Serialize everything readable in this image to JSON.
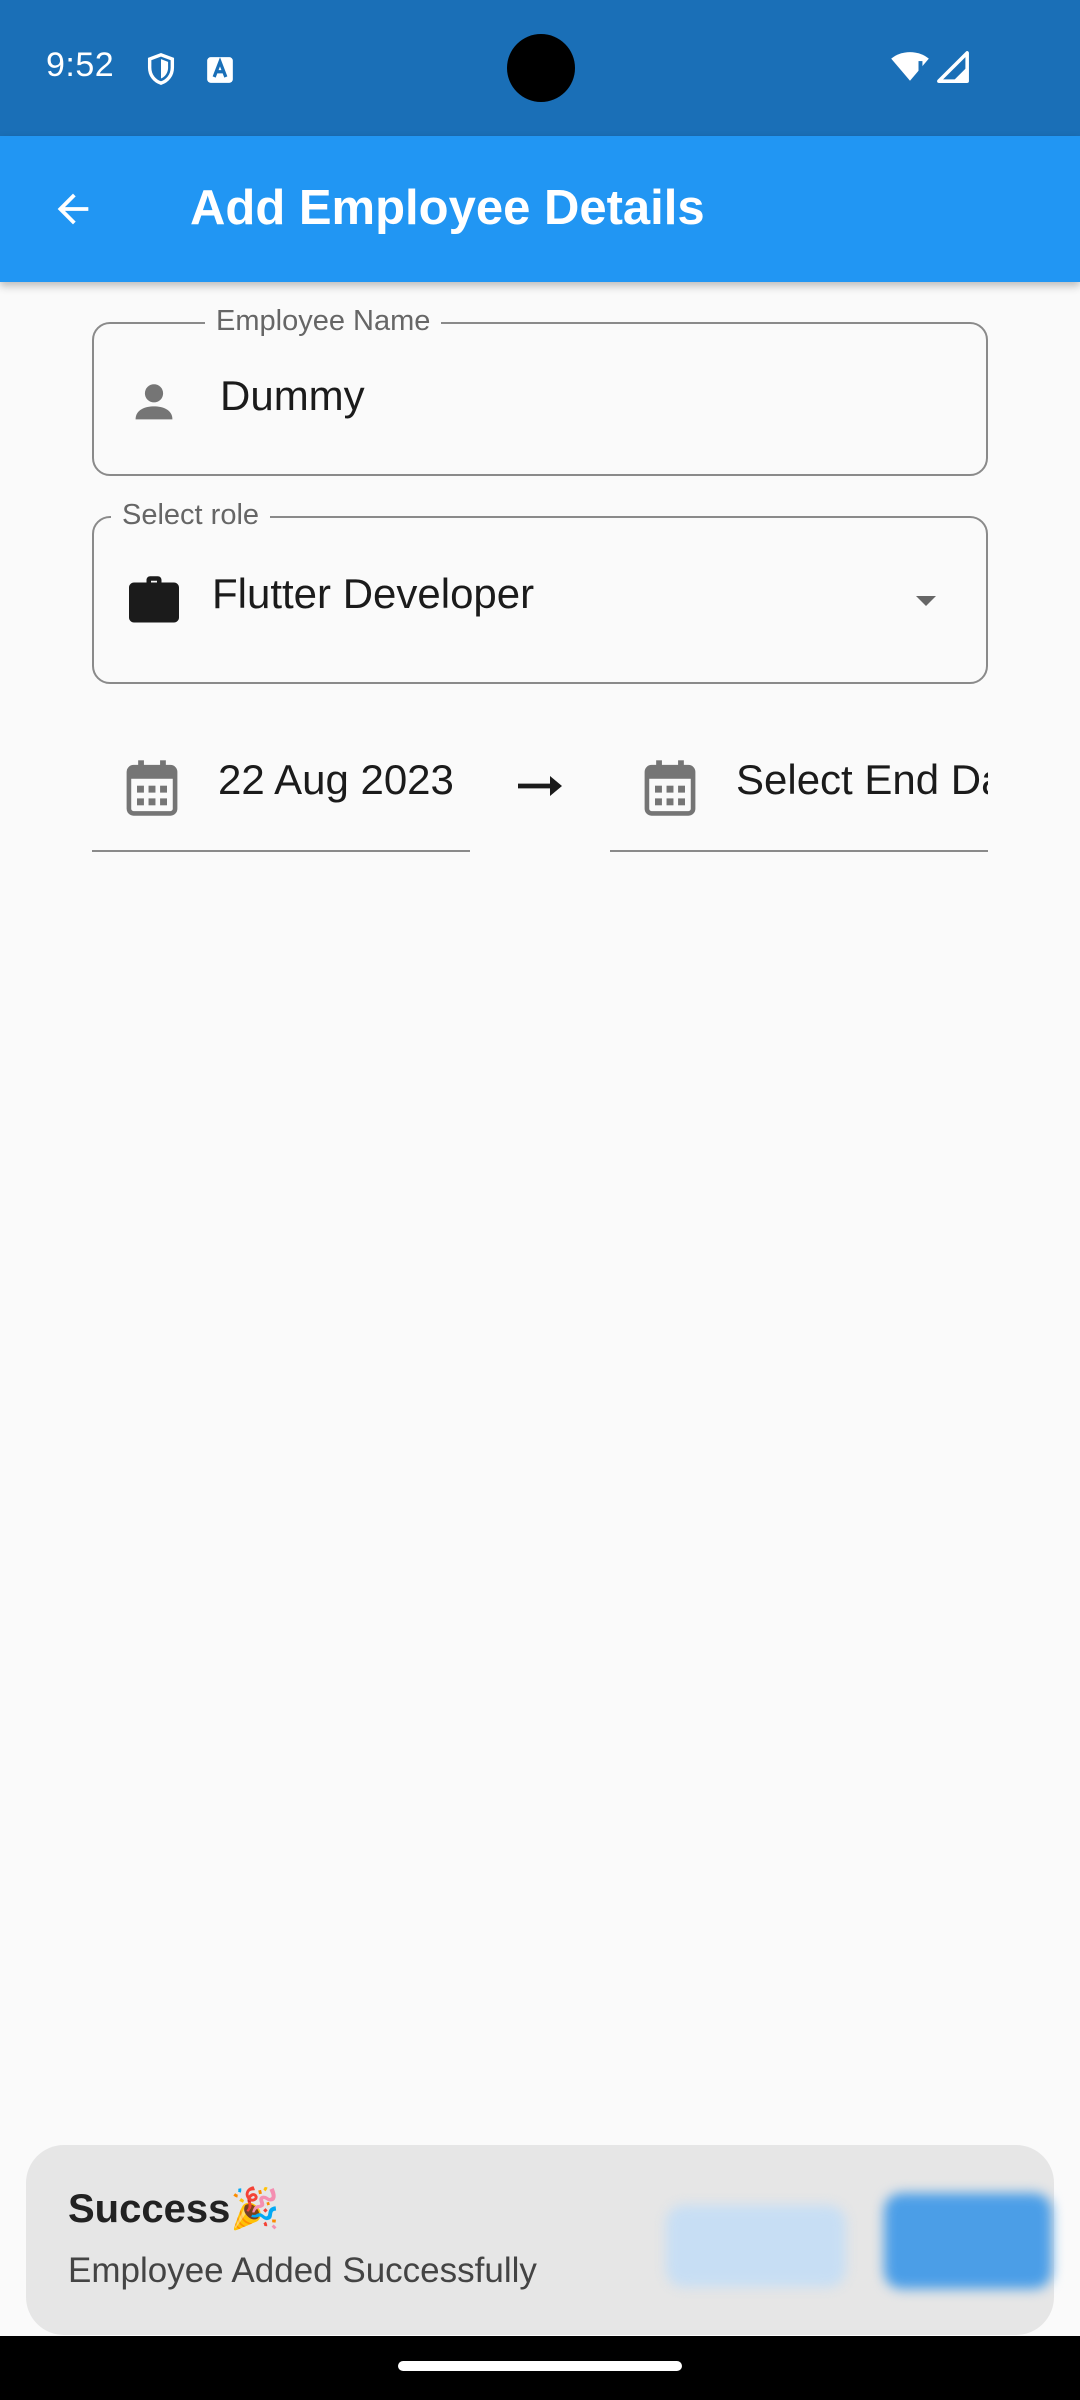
{
  "status_bar": {
    "time": "9:52",
    "icons": [
      "shield-icon",
      "font-a-icon",
      "wifi-alert-icon",
      "cell-signal-icon"
    ]
  },
  "app_bar": {
    "title": "Add Employee Details",
    "back_icon": "arrow-back-icon",
    "color": "#2196f3"
  },
  "form": {
    "employee_name": {
      "label": "Employee Name",
      "value": "Dummy",
      "icon": "person-icon"
    },
    "role": {
      "label": "Select role",
      "value": "Flutter Developer",
      "icon": "briefcase-icon",
      "dropdown_icon": "caret-down-icon"
    },
    "start_date": {
      "value": "22 Aug 2023",
      "icon": "calendar-icon"
    },
    "separator_icon": "arrow-right-icon",
    "end_date": {
      "value": "Select End Da",
      "icon": "calendar-icon"
    }
  },
  "snackbar": {
    "title": "Success",
    "emoji": "🎉",
    "message": "Employee Added Successfully"
  }
}
